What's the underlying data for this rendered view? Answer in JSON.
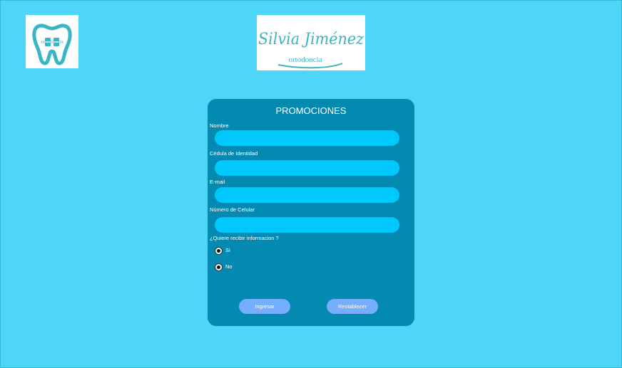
{
  "brand": {
    "logo_left_icon": "tooth-with-braces-icon",
    "logo_name": "Silvia Jiménez",
    "logo_tagline": "ortodoncia"
  },
  "colors": {
    "background": "#4dd6f8",
    "card": "#0489b1",
    "input": "#00c8fc",
    "button": "#74aefc",
    "logo_teal": "#3ab5c4"
  },
  "form": {
    "title": "PROMOCIONES",
    "fields": [
      {
        "label": "Nombre",
        "value": "",
        "placeholder": ""
      },
      {
        "label": "Cédula de Identidad",
        "value": "",
        "placeholder": ""
      },
      {
        "label": "E-mail",
        "value": "",
        "placeholder": ""
      },
      {
        "label": "Número de Celular",
        "value": "",
        "placeholder": ""
      }
    ],
    "question": "¿Quiere recibir informacion ?",
    "options": [
      {
        "label": "Si"
      },
      {
        "label": "No"
      }
    ],
    "submit_label": "Ingresar",
    "reset_label": "Restablecer"
  }
}
